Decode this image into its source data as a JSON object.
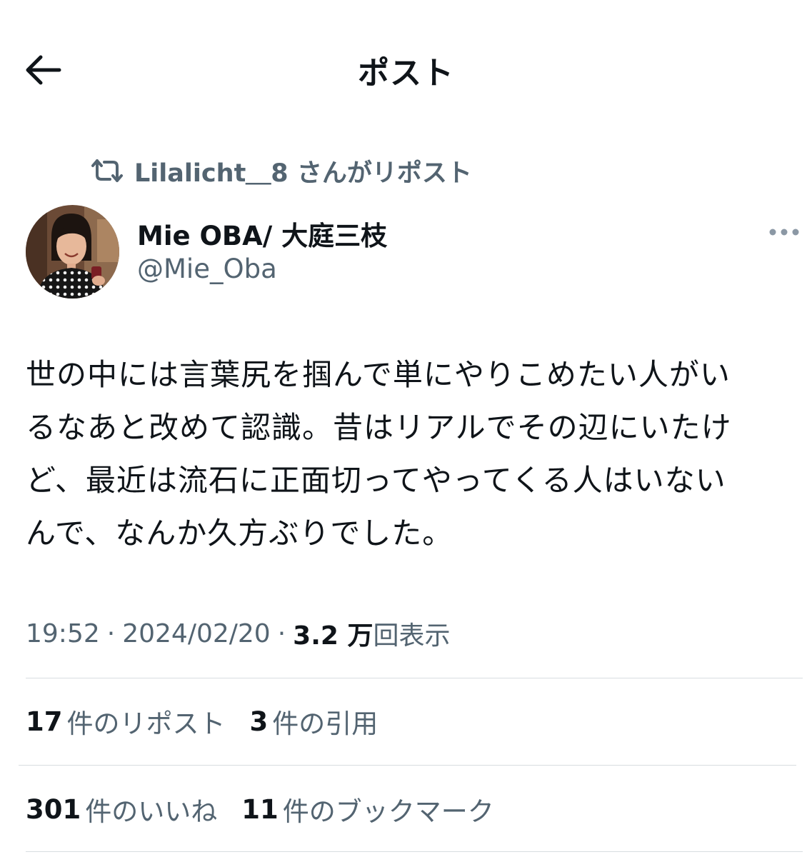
{
  "header": {
    "title": "ポスト",
    "back_icon": "arrow-left-icon"
  },
  "repost_context": {
    "icon": "repost-icon",
    "text": "Lilalicht＿8 さんがリポスト"
  },
  "author": {
    "name": "Mie OBA/ 大庭三枝",
    "handle": "@Mie_Oba"
  },
  "tweet": {
    "text": "世の中には言葉尻を掴んで単にやりこめたい人がい\nるなあと改めて認識。昔はリアルでその辺にいたけ\nど、最近は流石に正面切ってやってくる人はいない\nんで、なんか久方ぶりでした。"
  },
  "meta": {
    "time": "19:52",
    "separator": "·",
    "date": "2024/02/20",
    "views_count": "3.2 万",
    "views_label": "回表示"
  },
  "stats": {
    "reposts_count": "17",
    "reposts_label": "件のリポスト",
    "quotes_count": "3",
    "quotes_label": "件の引用",
    "likes_count": "301",
    "likes_label": "件のいいね",
    "bookmarks_count": "11",
    "bookmarks_label": "件のブックマーク"
  },
  "colors": {
    "text_primary": "#0f1419",
    "text_secondary": "#536471",
    "divider": "#d8dde0"
  }
}
